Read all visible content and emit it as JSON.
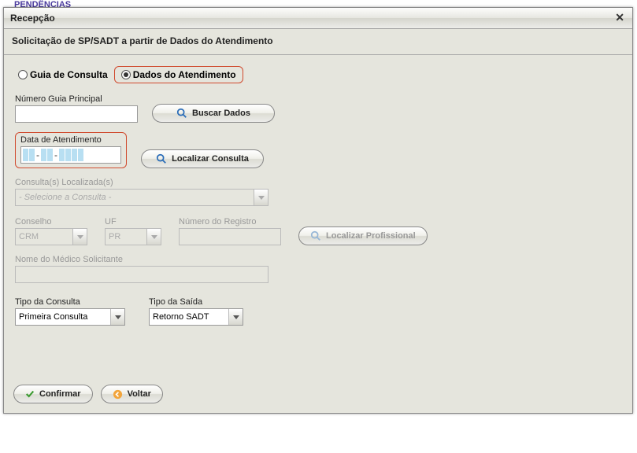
{
  "backdrop": "PENDÊNCIAS",
  "window": {
    "title": "Recepção"
  },
  "subtitle": "Solicitação de SP/SADT a partir de Dados do Atendimento",
  "radios": {
    "guia": {
      "label": "Guia de Consulta",
      "checked": false
    },
    "dados": {
      "label": "Dados do Atendimento",
      "checked": true
    }
  },
  "numeroGuia": {
    "label": "Número Guia Principal",
    "value": ""
  },
  "btnBuscar": "Buscar Dados",
  "dataAtend": {
    "label": "Data de Atendimento"
  },
  "btnLocalizarConsulta": "Localizar Consulta",
  "consultasLoc": {
    "label": "Consulta(s) Localizada(s)",
    "placeholder": "- Selecione a Consulta -"
  },
  "conselho": {
    "label": "Conselho",
    "value": "CRM"
  },
  "uf": {
    "label": "UF",
    "value": "PR"
  },
  "numeroRegistro": {
    "label": "Número do Registro",
    "value": ""
  },
  "btnLocalizarProf": "Localizar Profissional",
  "nomeMedico": {
    "label": "Nome do Médico Solicitante",
    "value": ""
  },
  "tipoConsulta": {
    "label": "Tipo da Consulta",
    "value": "Primeira Consulta"
  },
  "tipoSaida": {
    "label": "Tipo da Saída",
    "value": "Retorno SADT"
  },
  "btnConfirmar": "Confirmar",
  "btnVoltar": "Voltar"
}
